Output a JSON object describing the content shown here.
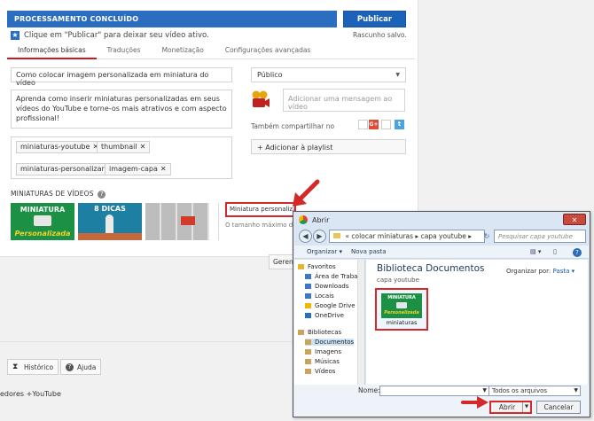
{
  "youtube": {
    "status": "PROCESSAMENTO CONCLUÍDO",
    "publish_label": "Publicar",
    "hint": "Clique em \"Publicar\" para deixar seu vídeo ativo.",
    "draft_saved": "Rascunho salvo.",
    "tabs": [
      "Informações básicas",
      "Traduções",
      "Monetização",
      "Configurações avançadas"
    ],
    "title_value": "Como colocar imagem personalizada em miniatura do vídeo",
    "description_value": "Aprenda como inserir miniaturas personalizadas em seus vídeos do YouTube e torne-os mais atrativos e com aspecto profissional!",
    "tags": [
      "miniaturas-youtube",
      "thumbnail",
      "miniaturas-personalizar",
      "imagem-capa"
    ],
    "privacy_value": "Público",
    "share_placeholder": "Adicionar uma mensagem ao vídeo",
    "share_label": "Também compartilhar no",
    "playlist_label": "+ Adicionar à playlist",
    "thumbnails_title": "MINIATURAS DE VÍDEOS",
    "thumb1_caption_top": "MINIATURA",
    "thumb1_caption_bottom": "Personalizada",
    "thumb2_caption": "8 DICAS",
    "custom_thumb_label": "Miniatura personalizada",
    "thumb_size_note": "O tamanho máximo do ar",
    "manage_label": "Gerenc",
    "history_label": "Histórico",
    "help_label": "Ajuda",
    "footer_links": "edores   +YouTube"
  },
  "dialog": {
    "title": "Abrir",
    "close_glyph": "✕",
    "breadcrumb": "«  colocar miniaturas  ▸  capa youtube  ▸",
    "search_placeholder": "Pesquisar capa youtube",
    "organize_label": "Organizar ▾",
    "new_folder_label": "Nova pasta",
    "tree_items": [
      {
        "label": "Favoritos",
        "color": "#e8b531"
      },
      {
        "label": "Área de Trabalh",
        "color": "#3b78c9"
      },
      {
        "label": "Downloads",
        "color": "#3b78c9"
      },
      {
        "label": "Locais",
        "color": "#3b78c9"
      },
      {
        "label": "Google Drive",
        "color": "#f4b400"
      },
      {
        "label": "OneDrive",
        "color": "#2a6fc4"
      },
      {
        "label": "Bibliotecas",
        "color": "#c9a55a"
      },
      {
        "label": "Documentos",
        "color": "#c9a55a"
      },
      {
        "label": "Imagens",
        "color": "#c9a55a"
      },
      {
        "label": "Músicas",
        "color": "#c9a55a"
      },
      {
        "label": "Vídeos",
        "color": "#c9a55a"
      }
    ],
    "library_title": "Biblioteca Documentos",
    "library_sub": "capa youtube",
    "arrange_label": "Organizar por:",
    "arrange_value": "Pasta ▾",
    "file_thumb_top": "MINIATURA",
    "file_thumb_bottom": "Personalizada",
    "file_name": "miniaturas",
    "name_label": "Nome:",
    "type_value": "Todos os arquivos",
    "open_label": "Abrir",
    "cancel_label": "Cancelar"
  },
  "colors": {
    "accent_blue": "#2b6dbf",
    "highlight_red": "#d22a28",
    "thumb_green": "#1c9146"
  }
}
